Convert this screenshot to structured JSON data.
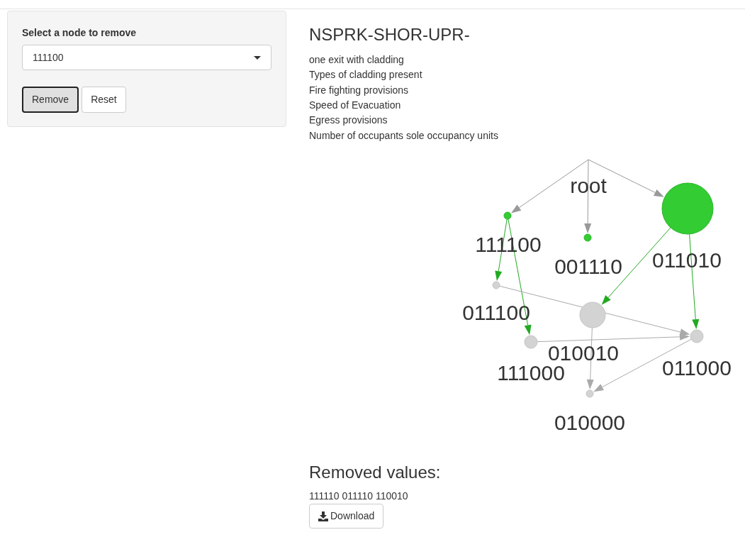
{
  "sidebar": {
    "select_label": "Select a node to remove",
    "select_value": "111100",
    "buttons": [
      {
        "label": "Remove",
        "focused": true
      },
      {
        "label": "Reset",
        "focused": false
      }
    ]
  },
  "main": {
    "title": "NSPRK-SHOR-UPR-",
    "lines": [
      "one exit with cladding",
      "Types of cladding present",
      "Fire fighting provisions",
      "Speed of Evacuation",
      "Egress provisions",
      "Number of occupants sole occupancy units"
    ],
    "graph": {
      "nodes": [
        {
          "label": "root",
          "kind": "root"
        },
        {
          "label": "111100",
          "kind": "node",
          "color": "#33cc33"
        },
        {
          "label": "001110",
          "kind": "node",
          "color": "#33cc33"
        },
        {
          "label": "011010",
          "kind": "node",
          "color": "#33cc33"
        },
        {
          "label": "011100",
          "kind": "node",
          "color": "#d3d3d3"
        },
        {
          "label": "010010",
          "kind": "node",
          "color": "#d3d3d3"
        },
        {
          "label": "111000",
          "kind": "node",
          "color": "#d3d3d3"
        },
        {
          "label": "011000",
          "kind": "node",
          "color": "#d3d3d3"
        },
        {
          "label": "010000",
          "kind": "node",
          "color": "#d3d3d3"
        }
      ]
    },
    "removed_heading": "Removed values:",
    "removed_values": "111110 011110 110010",
    "download_label": "Download"
  }
}
